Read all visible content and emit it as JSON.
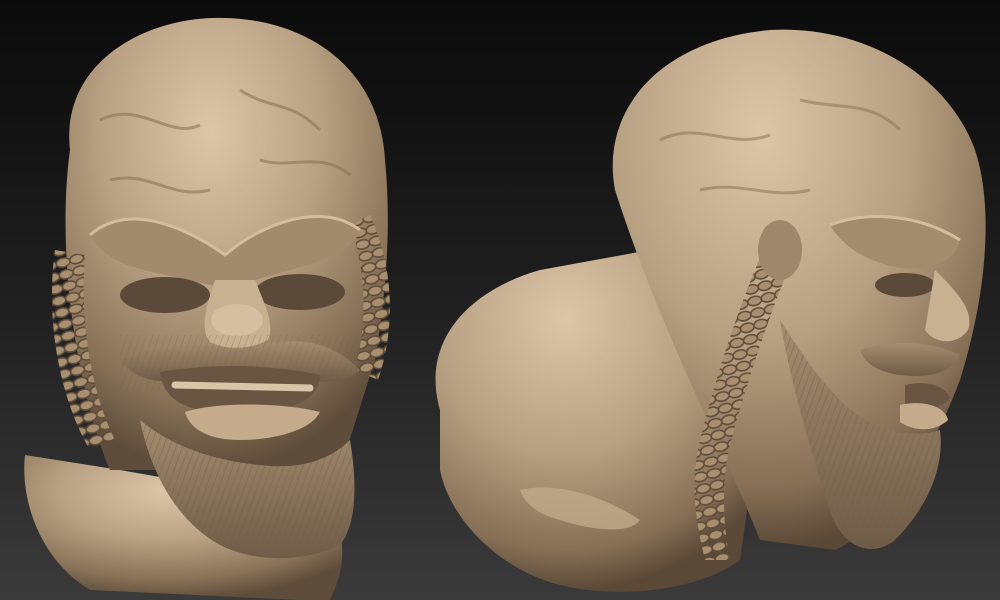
{
  "scene": {
    "description_visible_text": "",
    "background_colors": {
      "top": "#0b0b0b",
      "bottom": "#3a3a3a"
    },
    "clay_color": "#b19a7d",
    "clay_highlight": "#d8c2a4",
    "clay_shadow": "#5c4c3a",
    "models": [
      {
        "view": "front",
        "subject": "bearded-warrior-head-sculpt"
      },
      {
        "view": "three-quarter-right",
        "subject": "bearded-warrior-head-sculpt"
      }
    ]
  }
}
